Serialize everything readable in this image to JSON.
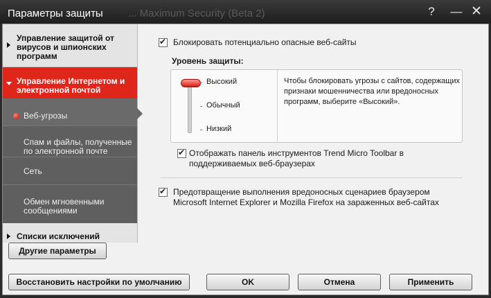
{
  "window": {
    "title": "Параметры защиты",
    "ghost_title": "... Maximum Security (Beta 2)",
    "help_label": "?",
    "minimize_label": "—",
    "close_label": "✕"
  },
  "sidebar": {
    "section1": "Управление защитой от вирусов и шпионских программ",
    "section2": "Управление Интернетом и электронной почтой",
    "subitems": [
      "Веб-угрозы",
      "Спам и файлы, полученные по электронной почте",
      "Сеть",
      "Обмен мгновенными сообщениями"
    ],
    "section3": "Списки исключений"
  },
  "content": {
    "block_sites_label": "Блокировать потенциально опасные веб-сайты",
    "level_title": "Уровень защиты:",
    "levels": [
      "Высокий",
      "Обычный",
      "Низкий"
    ],
    "selected_level": "Высокий",
    "level_description": "Чтобы блокировать угрозы с сайтов, содержащих признаки мошенничества или вредоносных программ, выберите «Высокий».",
    "toolbar_label": "Отображать панель инструментов Trend Micro Toolbar в поддерживаемых веб-браузерах",
    "script_prevention_label": "Предотвращение выполнения вредоносных сценариев браузером Microsoft Internet Explorer и Mozilla Firefox на зараженных веб-сайтах"
  },
  "buttons": {
    "other_params": "Другие параметры",
    "restore_defaults": "Восстановить настройки по умолчанию",
    "ok": "OK",
    "cancel": "Отмена",
    "apply": "Применить"
  },
  "colors": {
    "accent": "#e0261b",
    "sidebar_dark": "#5f5f5f",
    "titlebar": "#1e1e1e"
  }
}
